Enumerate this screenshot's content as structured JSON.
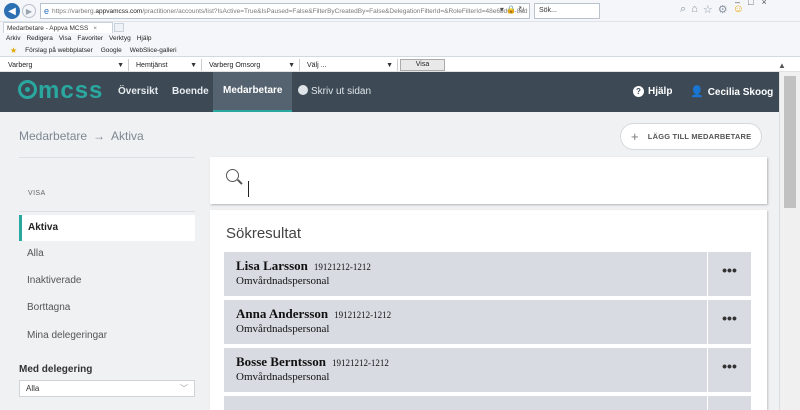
{
  "browser": {
    "url_prefix": "https://varberg.",
    "url_domain": "appvamcss.com",
    "url_rest": "/practitioner/accounts/list?IsActive=True&IsPaused=False&FilterByCreatedBy=False&DelegationFilterId=&RoleFilterId=48e6bd69-8ad",
    "search_placeholder": "Sök...",
    "tab_title": "Medarbetare - Appva MCSS",
    "menu": [
      "Arkiv",
      "Redigera",
      "Visa",
      "Favoriter",
      "Verktyg",
      "Hjälp"
    ],
    "favorites": [
      "Förslag på webbplatser",
      "Google",
      "WebSlice-galleri"
    ]
  },
  "context_bar": {
    "selects": [
      "Varberg",
      "Hemtjänst",
      "Varberg Omsorg",
      "Välj ..."
    ],
    "visa_button": "Visa"
  },
  "app_nav": {
    "logo": "mcss",
    "items": [
      "Översikt",
      "Boende",
      "Medarbetare"
    ],
    "active_item": "Medarbetare",
    "print_label": "Skriv ut sidan",
    "help_label": "Hjälp",
    "user_label": "Cecilia Skoog"
  },
  "breadcrumb": {
    "root": "Medarbetare",
    "current": "Aktiva",
    "separator": "→"
  },
  "add_button": {
    "label": "LÄGG TILL MEDARBETARE",
    "icon": "+"
  },
  "sidebar": {
    "visa_label": "VISA",
    "items": [
      "Aktiva",
      "Alla",
      "Inaktiverade",
      "Borttagna",
      "Mina delegeringar"
    ],
    "active": "Aktiva",
    "delegation_title": "Med delegering",
    "delegation_value": "Alla"
  },
  "search": {
    "value": ""
  },
  "results": {
    "title": "Sökresultat",
    "items": [
      {
        "name": "Lisa Larsson",
        "pnr": "19121212-1212",
        "role": "Omvårdnadspersonal"
      },
      {
        "name": "Anna Andersson",
        "pnr": "19121212-1212",
        "role": "Omvårdnadspersonal"
      },
      {
        "name": "Bosse Berntsson",
        "pnr": "19121212-1212",
        "role": "Omvårdnadspersonal"
      }
    ],
    "more_label": "•••"
  },
  "colors": {
    "nav_bg": "#3d4a56",
    "accent": "#2aa8a0",
    "page_bg": "#f0f1f3",
    "row_bg": "#d8dbe2"
  }
}
